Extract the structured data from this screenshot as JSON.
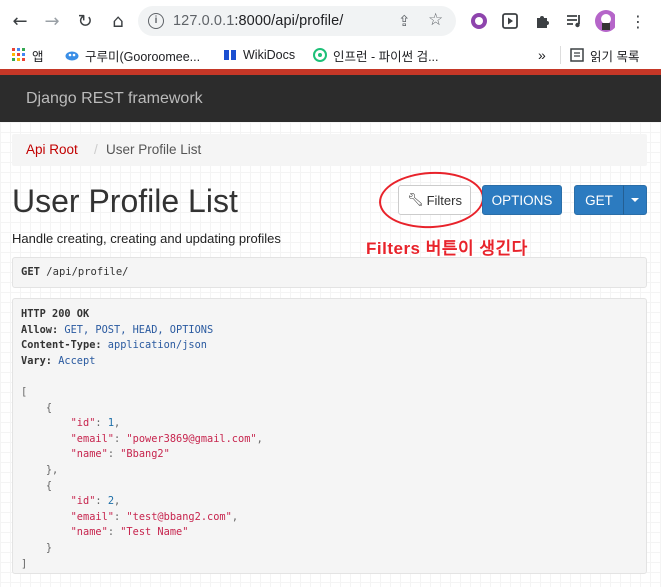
{
  "browser": {
    "url_host": "127.0.0.1",
    "url_rest": ":8000/api/profile/",
    "bookmarks": [
      {
        "label": "앱"
      },
      {
        "label": "구루미(Gooroomee..."
      },
      {
        "label": "WikiDocs"
      },
      {
        "label": "인프런 - 파이썬 검..."
      },
      {
        "label": "»"
      },
      {
        "label": "읽기 목록"
      }
    ]
  },
  "navbar": {
    "brand": "Django REST framework"
  },
  "breadcrumb": {
    "root": "Api Root",
    "separator": "/",
    "current": "User Profile List"
  },
  "page": {
    "title": "User Profile List",
    "description": "Handle creating, creating and updating profiles"
  },
  "buttons": {
    "filters": "Filters",
    "options": "OPTIONS",
    "get": "GET"
  },
  "annotation": "Filters 버튼이 생긴다",
  "request": {
    "method": "GET",
    "path": "/api/profile/"
  },
  "response": {
    "status": "HTTP 200 OK",
    "headers": [
      {
        "key": "Allow:",
        "value": "GET, POST, HEAD, OPTIONS"
      },
      {
        "key": "Content-Type:",
        "value": "application/json"
      },
      {
        "key": "Vary:",
        "value": "Accept"
      }
    ],
    "profiles": [
      {
        "id": "1",
        "email": "\"power3869@gmail.com\"",
        "name": "\"Bbang2\""
      },
      {
        "id": "2",
        "email": "\"test@bbang2.com\"",
        "name": "\"Test Name\""
      }
    ],
    "keys": {
      "id": "\"id\"",
      "email": "\"email\"",
      "name": "\"name\""
    }
  },
  "colors": {
    "accent": "#c53727",
    "primary_button": "#2c7bc0",
    "navbar": "#2c2c2c",
    "annotation": "#e8232b"
  }
}
